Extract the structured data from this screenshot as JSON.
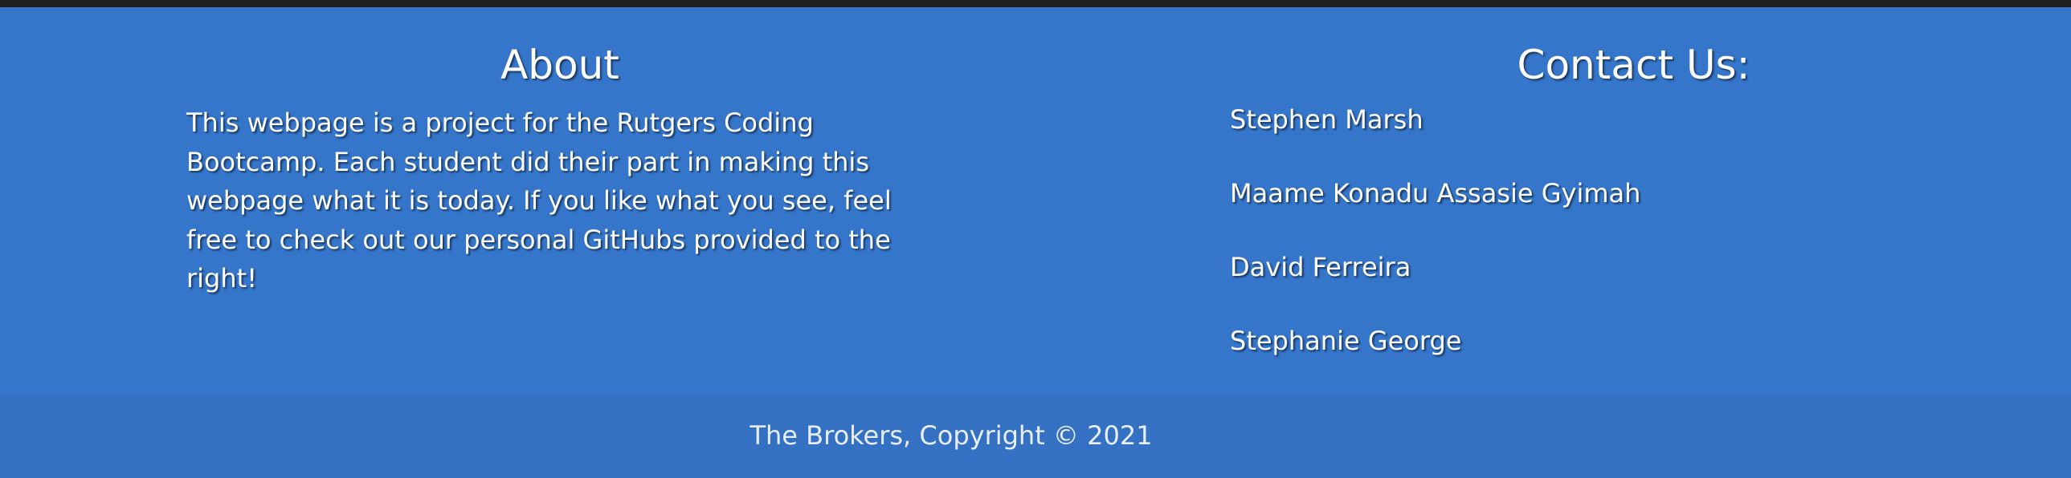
{
  "about": {
    "title": "About",
    "text": "This webpage is a project for the Rutgers Coding Bootcamp. Each student did their part in making this webpage what it is today. If you like what you see, feel free to check out our personal GitHubs provided to the right!"
  },
  "contact": {
    "title": "Contact Us:",
    "people": [
      "Stephen Marsh",
      "Maame Konadu Assasie Gyimah",
      "David Ferreira",
      "Stephanie George"
    ]
  },
  "copyright": "The Brokers, Copyright © 2021",
  "colors": {
    "background": "#3576cb",
    "bottom_bar": "#3571c2",
    "top_border": "#1e1e1e",
    "text": "#ffffff"
  }
}
